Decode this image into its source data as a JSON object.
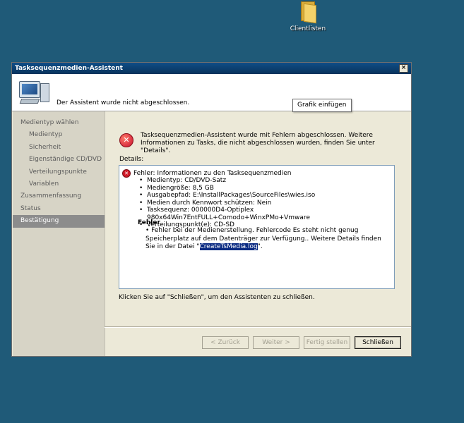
{
  "desktop": {
    "icon_label": "Clientlisten"
  },
  "window": {
    "title": "Tasksequenzmedien-Assistent",
    "header_message": "Der Assistent wurde nicht abgeschlossen.",
    "tooltip": "Grafik einfügen"
  },
  "sidebar": {
    "items": [
      {
        "label": "Medientyp wählen",
        "level": 1
      },
      {
        "label": "Medientyp",
        "level": 2
      },
      {
        "label": "Sicherheit",
        "level": 2
      },
      {
        "label": "Eigenständige CD/DVD",
        "level": 2
      },
      {
        "label": "Verteilungspunkte",
        "level": 2
      },
      {
        "label": "Variablen",
        "level": 2
      },
      {
        "label": "Zusammenfassung",
        "level": 1
      },
      {
        "label": "Status",
        "level": 1
      },
      {
        "label": "Bestätigung",
        "level": 1,
        "active": true
      }
    ]
  },
  "content": {
    "error_message": "Tasksequenzmedien-Assistent wurde mit Fehlern abgeschlossen. Weitere Informationen zu Tasks, die nicht abgeschlossen wurden, finden Sie unter \"Details\".",
    "details_label": "Details:",
    "details": {
      "head": "Fehler: Informationen zu den Tasksequenzmedien",
      "items": [
        "Medientyp: CD/DVD-Satz",
        "Mediengröße: 8,5 GB",
        "Ausgabepfad: E:\\InstallPackages\\SourceFiles\\wies.iso",
        "Medien durch Kennwort schützen: Nein",
        "Tasksequenz: 000000D4-Optiplex 980x64Win7EntFULL+Comodo+WinxPMo+Vmware",
        "Verteilungspunkt(e): CD-SD"
      ],
      "error_title": "Fehler",
      "error_text": "• Fehler bei der Medienerstellung. Fehlercode Es steht nicht genug Speicherplatz auf dem Datenträger zur Verfügung.. Weitere Details finden Sie in der Datei \"",
      "log_file": "CreateTsMedia.log",
      "error_suffix": "\"."
    },
    "footer_text": "Klicken Sie auf \"Schließen\", um den Assistenten zu schließen."
  },
  "buttons": {
    "back": "< Zurück",
    "next": "Weiter >",
    "finish": "Fertig stellen",
    "close": "Schließen"
  }
}
